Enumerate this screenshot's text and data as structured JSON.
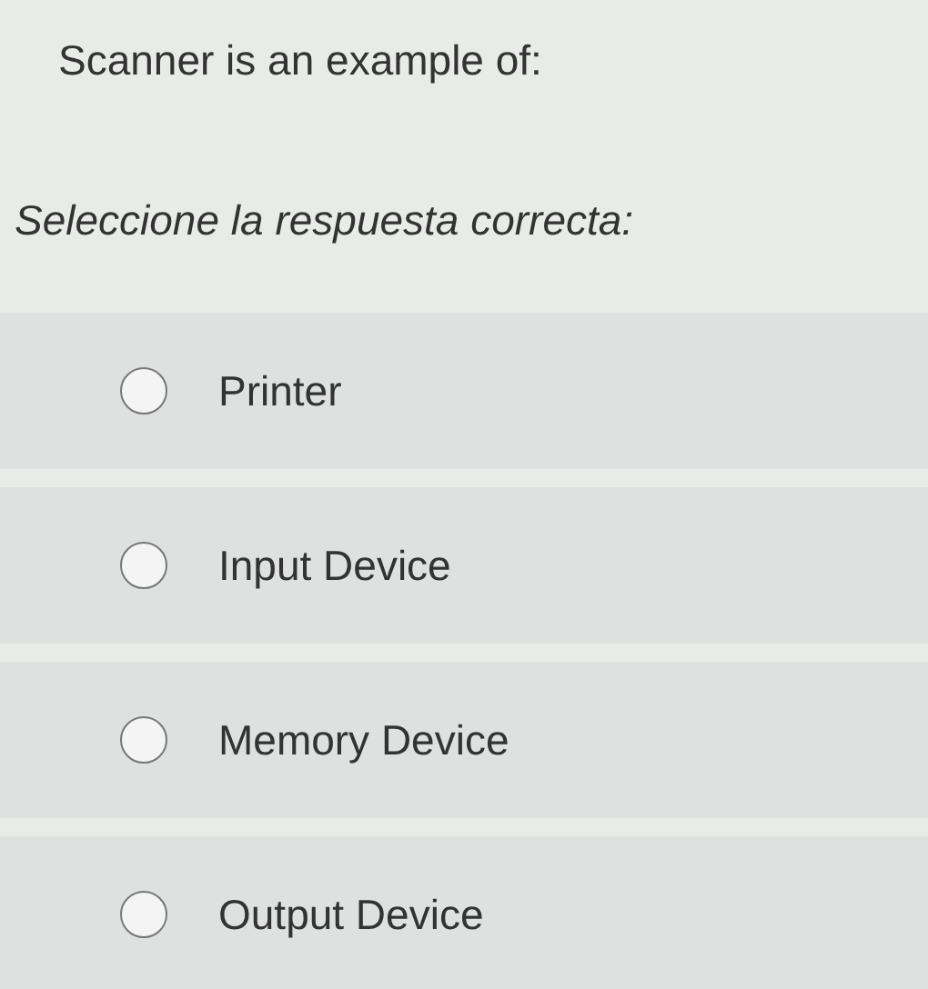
{
  "question": "Scanner is an example of:",
  "instruction": "Seleccione la respuesta correcta:",
  "options": [
    {
      "label": "Printer",
      "selected": false
    },
    {
      "label": "Input Device",
      "selected": false
    },
    {
      "label": "Memory Device",
      "selected": false
    },
    {
      "label": "Output Device",
      "selected": false
    }
  ]
}
